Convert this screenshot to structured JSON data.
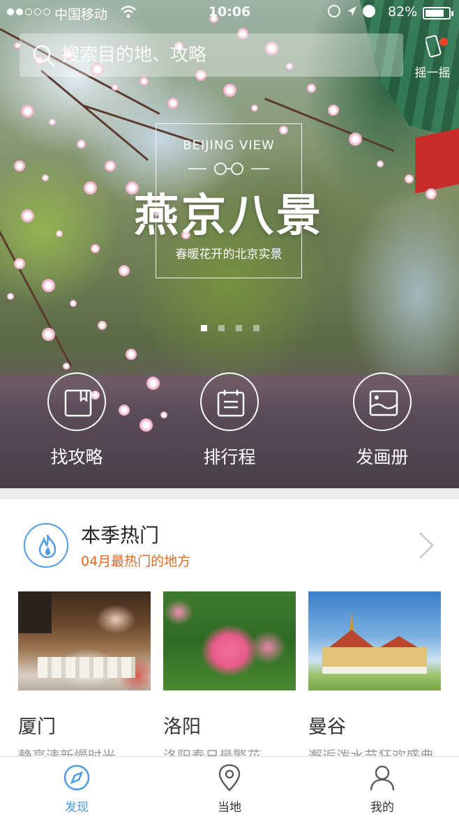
{
  "status_bar": {
    "carrier": "中国移动",
    "time": "10:06",
    "battery": "82%",
    "battery_level": 0.82
  },
  "search": {
    "placeholder": "搜索目的地、攻略",
    "icon": "search-icon"
  },
  "shake": {
    "label": "摇一摇",
    "icon": "shake-phone-icon",
    "badge_color": "#e8452b"
  },
  "banner": {
    "en_title": "BEIJING VIEW",
    "title": "燕京八景",
    "subtitle": "春暖花开的北京实景",
    "page_count": 4,
    "active_page": 1
  },
  "quick_actions": [
    {
      "label": "找攻略",
      "icon": "guide-book-icon"
    },
    {
      "label": "排行程",
      "icon": "itinerary-icon"
    },
    {
      "label": "发画册",
      "icon": "photo-album-icon"
    }
  ],
  "hot_section": {
    "title": "本季热门",
    "subtitle": "04月最热门的地方",
    "icon": "fire-icon",
    "accent": "#4f9be8",
    "subtitle_color": "#e7661c"
  },
  "destinations": [
    {
      "city": "厦门",
      "desc": "静享清新慢时光"
    },
    {
      "city": "洛阳",
      "desc": "洛阳春日最繁花"
    },
    {
      "city": "曼谷",
      "desc": "邂逅泼水节狂欢盛典"
    }
  ],
  "tabs": [
    {
      "label": "发现",
      "icon": "compass-icon",
      "active": true
    },
    {
      "label": "当地",
      "icon": "location-pin-icon",
      "active": false
    },
    {
      "label": "我的",
      "icon": "user-icon",
      "active": false
    }
  ],
  "colors": {
    "tab_active": "#4a9be8",
    "tab_inactive": "#333333"
  }
}
